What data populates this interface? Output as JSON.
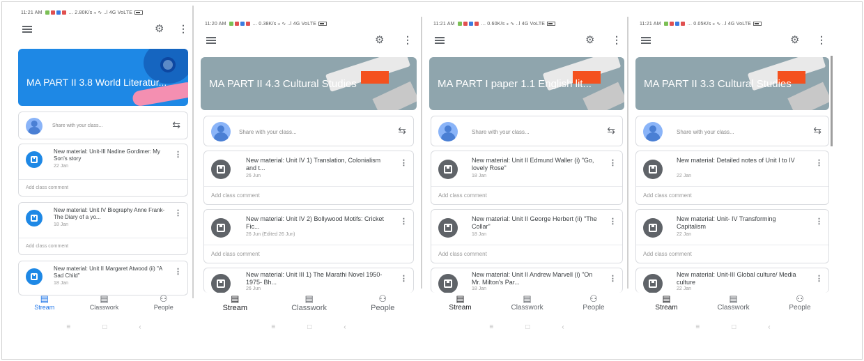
{
  "status_bars": [
    "11:21 AM",
    "11:20 AM",
    "11:21 AM",
    "11:21 AM"
  ],
  "status_speed": [
    "2.80K/s",
    "0.38K/s",
    "0.60K/s",
    "0.05K/s"
  ],
  "status_network": "4G VoLTE",
  "share_placeholder": "Share with your class...",
  "comment_placeholder": "Add class comment",
  "nav": {
    "stream": "Stream",
    "classwork": "Classwork",
    "people": "People"
  },
  "colors": {
    "banner_blue": "#1e88e5",
    "banner_gray": "#8fa5ad",
    "accent": "#1a73e8"
  },
  "phones": [
    {
      "banner_title": "MA PART II 3.8 World Literatur...",
      "posts": [
        {
          "title": "New material: Unit-III Nadine Gordimer: My Son's story",
          "date": "22 Jan"
        },
        {
          "title": "New material: Unit IV Biography Anne Frank- The Diary of a yo...",
          "date": "18 Jan"
        },
        {
          "title": "New material: Unit II Margaret Atwood (ii) \"A Sad Child\"",
          "date": "18 Jan"
        }
      ]
    },
    {
      "banner_title": "MA PART II 4.3 Cultural Studies",
      "posts": [
        {
          "title": "New material: Unit IV 1) Translation, Colonialism and t...",
          "date": "26 Jun"
        },
        {
          "title": "New material: Unit IV 2) Bollywood Motifs: Cricket Fic...",
          "date": "26 Jun (Edited 26 Jun)"
        },
        {
          "title": "New material: Unit III 1) The Marathi Novel 1950- 1975- Bh...",
          "date": "26 Jun"
        }
      ]
    },
    {
      "banner_title": "MA PART I paper 1.1 English lit...",
      "posts": [
        {
          "title": "New material: Unit II Edmund Waller (i) \"Go, lovely Rose\"",
          "date": "18 Jan"
        },
        {
          "title": "New material: Unit II George Herbert (ii) \"The Collar\"",
          "date": "18 Jan"
        },
        {
          "title": "New material: Unit II Andrew Marvell (i) \"On Mr. Milton's Par...",
          "date": "18 Jan"
        }
      ]
    },
    {
      "banner_title": "MA PART II 3.3 Cultural Studies",
      "posts": [
        {
          "title": "New material: Detailed notes of Unit I to IV",
          "date": "22 Jan"
        },
        {
          "title": "New material: Unit- IV Transforming Capitalism",
          "date": "22 Jan"
        },
        {
          "title": "New material: Unit-III Global culture/ Media culture",
          "date": "22 Jan"
        }
      ]
    }
  ]
}
